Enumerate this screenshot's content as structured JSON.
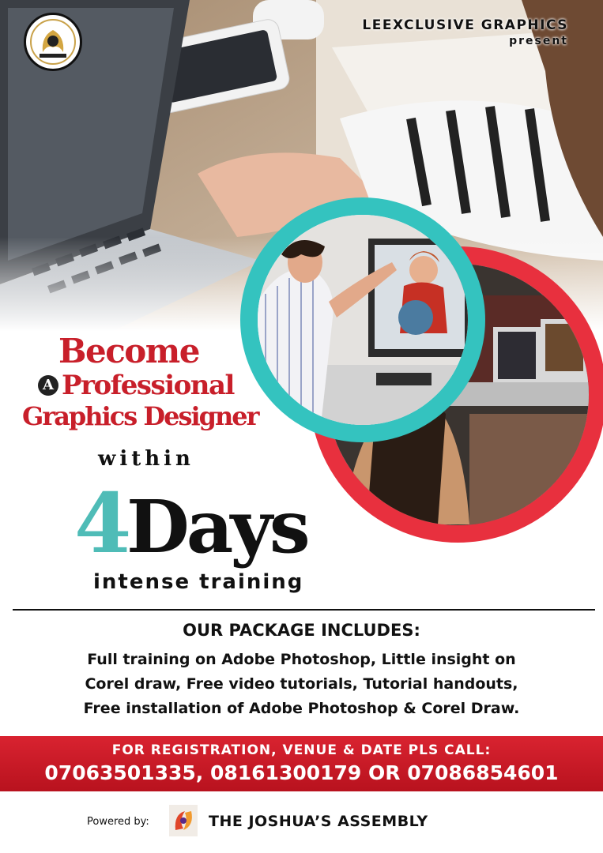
{
  "brand": {
    "name": "LEEXCLUSIVE GRAPHICS",
    "present": "present"
  },
  "headline": {
    "line1": "Become",
    "badge": "A",
    "line2": "Professional",
    "line3": "Graphics Designer"
  },
  "duration": {
    "within": "within",
    "number": "4",
    "unit": "Days",
    "subtitle": "intense training"
  },
  "package": {
    "title": "OUR PACKAGE INCLUDES:",
    "lines": [
      "Full training on Adobe Photoshop, Little insight on",
      "Corel draw, Free video tutorials, Tutorial handouts,",
      "Free installation of Adobe Photoshop & Corel Draw."
    ]
  },
  "registration": {
    "label": "FOR REGISTRATION, VENUE & DATE PLS CALL:",
    "phones": "07063501335, 08161300179 OR 07086854601"
  },
  "footer": {
    "powered_by": "Powered by:",
    "organizer": "THE JOSHUA’S ASSEMBLY"
  },
  "colors": {
    "accent_red": "#c81f2a",
    "accent_teal": "#34c3bf",
    "band_red": "#d92330"
  },
  "icons": {
    "brand_logo": "lion-emblem-logo",
    "organizer_logo": "joshuas-assembly-logo"
  }
}
